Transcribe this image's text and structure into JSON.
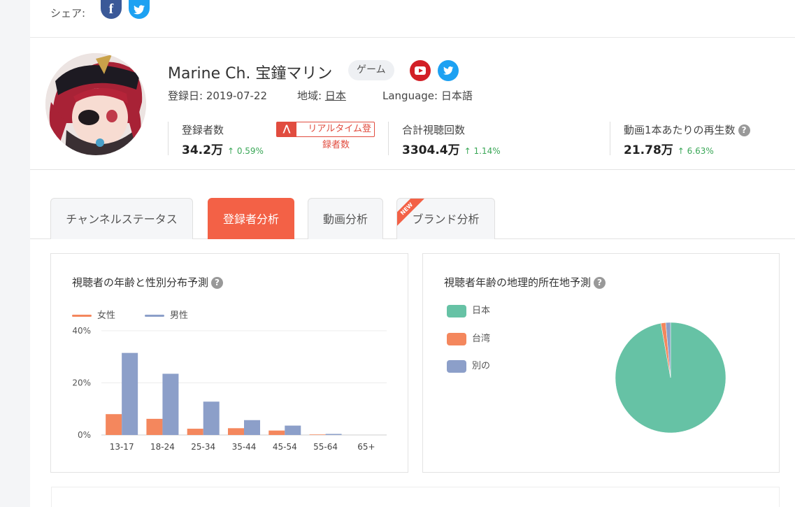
{
  "share": {
    "label": "シェア:",
    "facebook_glyph": "f",
    "twitter_glyph": "🐦"
  },
  "channel": {
    "name": "Marine Ch. 宝鐘マリン",
    "category": "ゲーム",
    "registered": "登録日: 2019-07-22",
    "region_label": "地域:",
    "region_value": "日本",
    "language_label": "Language:",
    "language_value": "日本語",
    "stats": [
      {
        "label": "登録者数",
        "value": "34.2万",
        "change": "0.59%"
      },
      {
        "label": "合計視聴回数",
        "value": "3304.4万",
        "change": "1.14%"
      },
      {
        "label": "動画1本あたりの再生数",
        "value": "21.78万",
        "change": "6.63%"
      }
    ],
    "realtime_badge_line1": "リアルタイム登",
    "realtime_badge_line2": "録者数"
  },
  "tabs": [
    {
      "label": "チャンネルステータス",
      "active": false
    },
    {
      "label": "登録者分析",
      "active": true
    },
    {
      "label": "動画分析",
      "active": false
    },
    {
      "label": "ブランド分析",
      "active": false,
      "ribbon": "NEW"
    }
  ],
  "colors": {
    "accent": "#f36146",
    "female": "#f4875d",
    "male": "#8c9fc9",
    "japan": "#66c2a5",
    "taiwan": "#f4875d",
    "other": "#8c9fc9"
  },
  "chart_data": [
    {
      "type": "bar",
      "title": "視聴者の年齢と性別分布予測",
      "categories": [
        "13-17",
        "18-24",
        "25-34",
        "35-44",
        "45-54",
        "55-64",
        "65+"
      ],
      "series": [
        {
          "name": "女性",
          "values": [
            8,
            6.2,
            2.4,
            2.6,
            1.7,
            0.2,
            0
          ]
        },
        {
          "name": "男性",
          "values": [
            31.5,
            23.5,
            12.8,
            5.7,
            3.6,
            0.4,
            0
          ]
        }
      ],
      "yticks": [
        "0%",
        "20%",
        "40%"
      ],
      "ylim": [
        0,
        40
      ]
    },
    {
      "type": "pie",
      "title": "視聴者年齢の地理的所在地予測",
      "labels": [
        "日本",
        "台湾",
        "別の"
      ],
      "values": [
        97.2,
        1.4,
        1.4
      ]
    }
  ]
}
